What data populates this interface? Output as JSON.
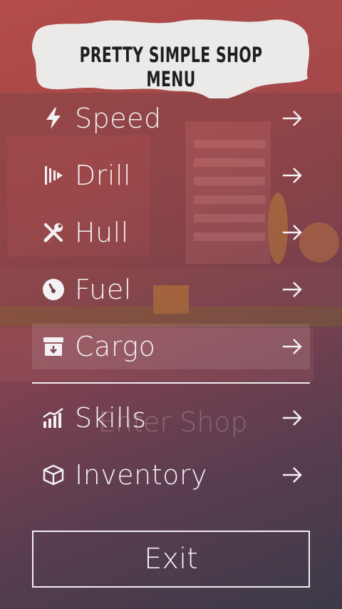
{
  "title": "PRETTY SIMPLE SHOP MENU",
  "background_text": "Enter Shop",
  "menu": {
    "items": [
      {
        "label": "Speed",
        "icon": "lightning-icon",
        "arrow": "→"
      },
      {
        "label": "Drill",
        "icon": "drill-icon",
        "arrow": "→"
      },
      {
        "label": "Hull",
        "icon": "tools-icon",
        "arrow": "→"
      },
      {
        "label": "Fuel",
        "icon": "gauge-icon",
        "arrow": "→"
      },
      {
        "label": "Cargo",
        "icon": "archive-box-icon",
        "arrow": "→"
      },
      {
        "label": "Skills",
        "icon": "bar-chart-icon",
        "arrow": "→"
      },
      {
        "label": "Inventory",
        "icon": "cube-icon",
        "arrow": "→"
      }
    ]
  },
  "exit_label": "Exit",
  "colors": {
    "accent": "#f4f1f4",
    "bg_top": "#b24c49",
    "bg_bottom": "#3c3a48"
  }
}
